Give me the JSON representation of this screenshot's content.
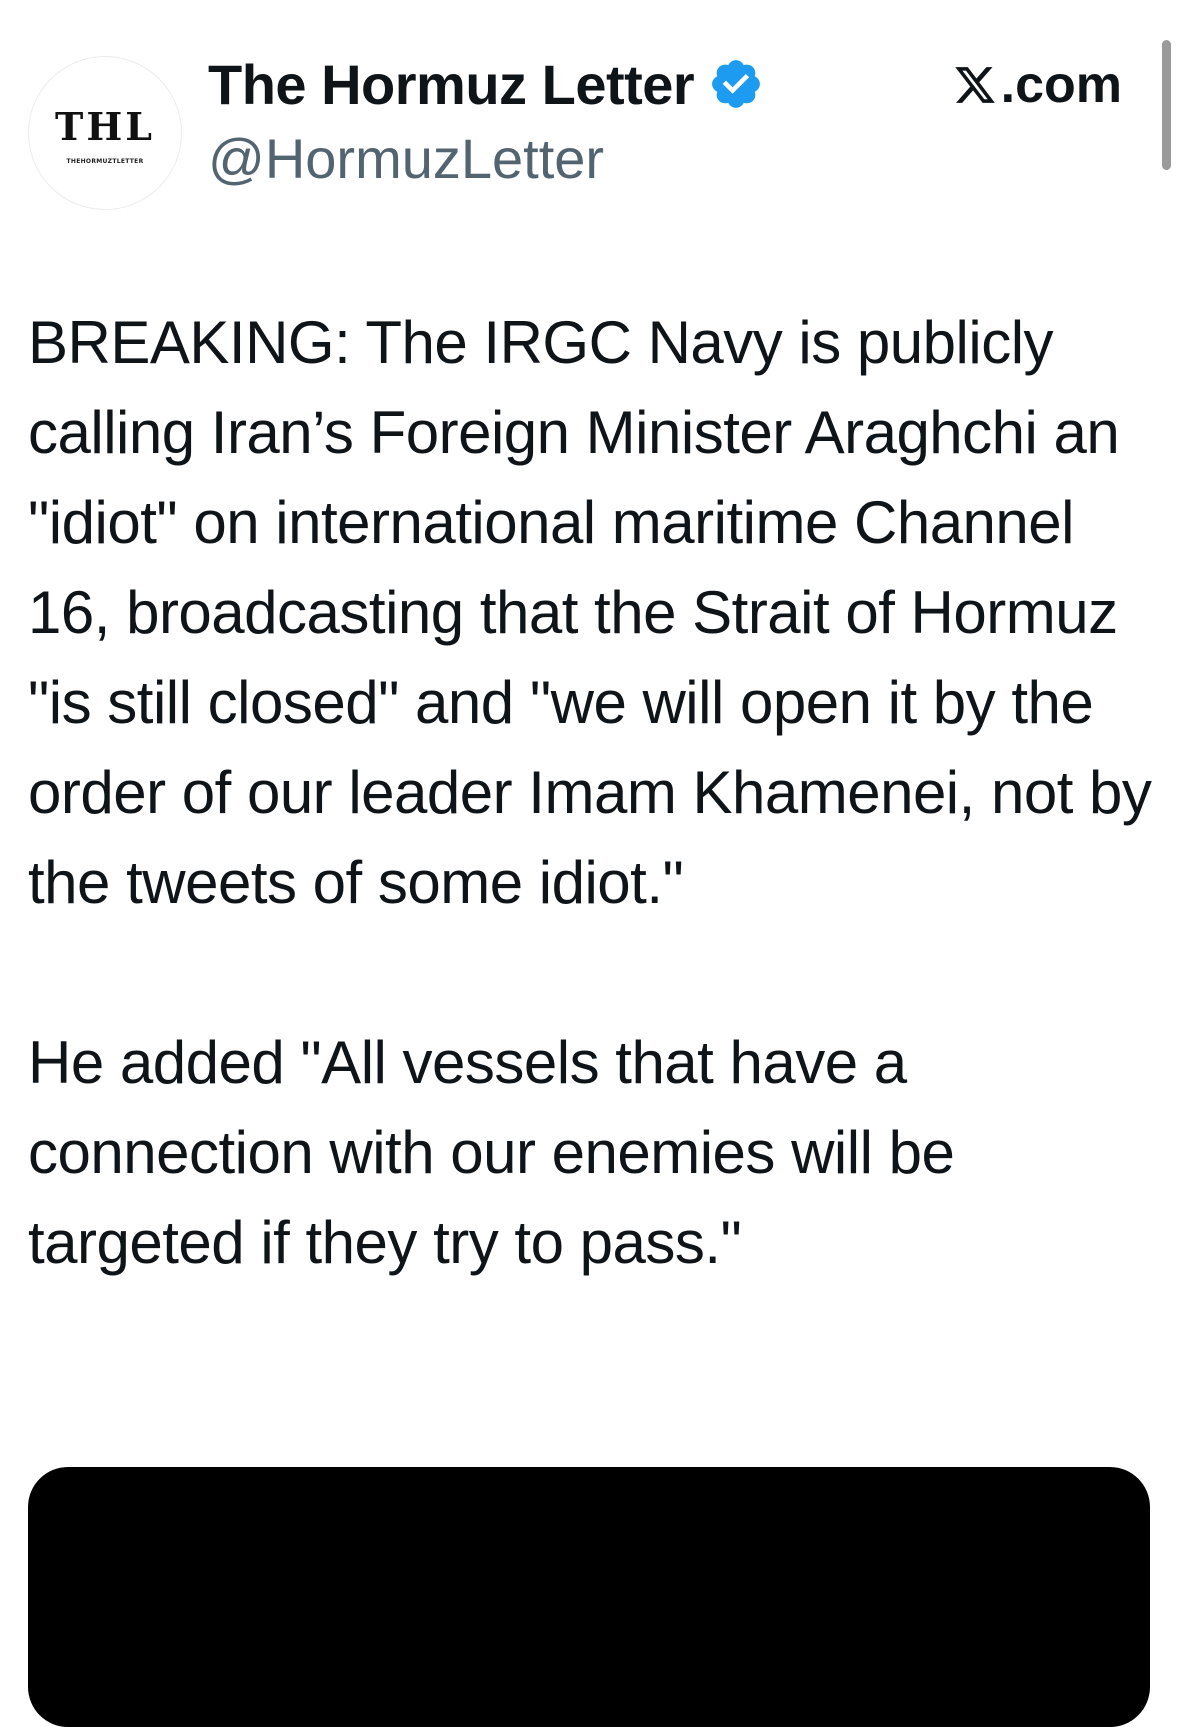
{
  "author": {
    "display_name": "The Hormuz Letter",
    "handle": "@HormuzLetter",
    "avatar_text": "THL",
    "avatar_subtext": "THEHORMUZTLETTER",
    "verified_icon": "verified-badge-icon",
    "verified_color": "#1d9bf0"
  },
  "source": {
    "label": ".com",
    "icon": "x-logo-icon"
  },
  "tweet": {
    "paragraphs": [
      "BREAKING: The IRGC Navy is publicly calling Iran’s Foreign Minister Araghchi an \"idiot\" on international maritime Channel 16, broadcasting that the Strait of Hormuz \"is still closed\" and \"we will open it by the order of our leader Imam Khamenei, not by the tweets of some idiot.\"",
      "He added \"All vessels that have a connection with our enemies will be targeted if they try to pass.\""
    ]
  },
  "colors": {
    "text": "#0f1419",
    "handle": "#536471",
    "media_background": "#000000"
  }
}
